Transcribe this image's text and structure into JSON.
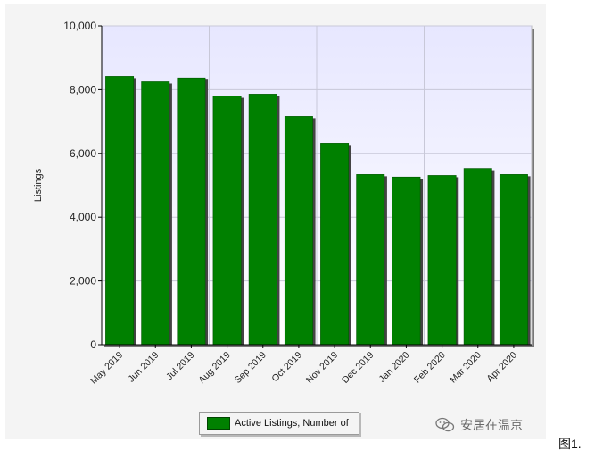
{
  "chart_data": {
    "type": "bar",
    "categories": [
      "May 2019",
      "Jun 2019",
      "Jul 2019",
      "Aug 2019",
      "Sep 2019",
      "Oct 2019",
      "Nov 2019",
      "Dec 2019",
      "Jan 2020",
      "Feb 2020",
      "Mar 2020",
      "Apr 2020"
    ],
    "series": [
      {
        "name": "Active Listings, Number of",
        "values": [
          8420,
          8250,
          8370,
          7800,
          7860,
          7160,
          6320,
          5340,
          5260,
          5310,
          5530,
          5340
        ]
      }
    ],
    "ylabel": "Listings",
    "ylim": [
      0,
      10000
    ],
    "yticks": [
      "0",
      "2,000",
      "4,000",
      "6,000",
      "8,000",
      "10,000"
    ],
    "ytick_values": [
      0,
      2000,
      4000,
      6000,
      8000,
      10000
    ],
    "grid": true,
    "legend": "bottom-center",
    "colors": {
      "bar": "#008000",
      "bar_shadow": "#444444",
      "plot_top": "#e7e7ff",
      "plot_bottom": "#ffffff"
    }
  },
  "legend": {
    "label": "Active Listings, Number of"
  },
  "watermark": {
    "text": "安居在温京"
  },
  "figure_label": "图1."
}
